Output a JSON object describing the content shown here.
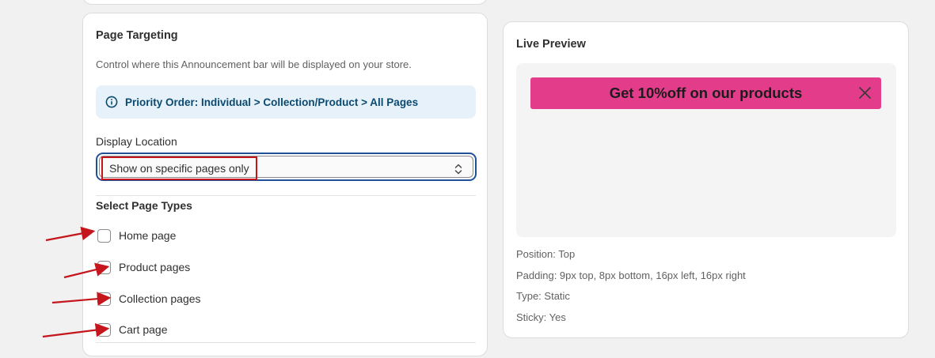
{
  "targeting": {
    "title": "Page Targeting",
    "description": "Control where this Announcement bar will be displayed on your store.",
    "priority_note": "Priority Order: Individual > Collection/Product > All Pages",
    "display_location": {
      "label": "Display Location",
      "selected": "Show on specific pages only"
    },
    "page_types": {
      "heading": "Select Page Types",
      "items": [
        {
          "label": "Home page",
          "checked": false
        },
        {
          "label": "Product pages",
          "checked": false
        },
        {
          "label": "Collection pages",
          "checked": false
        },
        {
          "label": "Cart page",
          "checked": false
        }
      ]
    }
  },
  "preview": {
    "title": "Live Preview",
    "announcement": {
      "text": "Get 10%off on our products",
      "background_color": "#e33c8a",
      "close_icon": "close-icon"
    },
    "position": "Position: Top",
    "padding": "Padding: 9px top, 8px bottom, 16px left, 16px right",
    "type": "Type: Static",
    "sticky": "Sticky: Yes"
  },
  "colors": {
    "annotation_red": "#c4161c",
    "focus_blue": "#1f5199",
    "info_bg": "#e6f1fa",
    "info_text": "#0b4a6f"
  },
  "icons": {
    "info": "info-circle-icon",
    "select": "chevron-up-down-icon",
    "annotation": "arrow-annotation-icon"
  }
}
